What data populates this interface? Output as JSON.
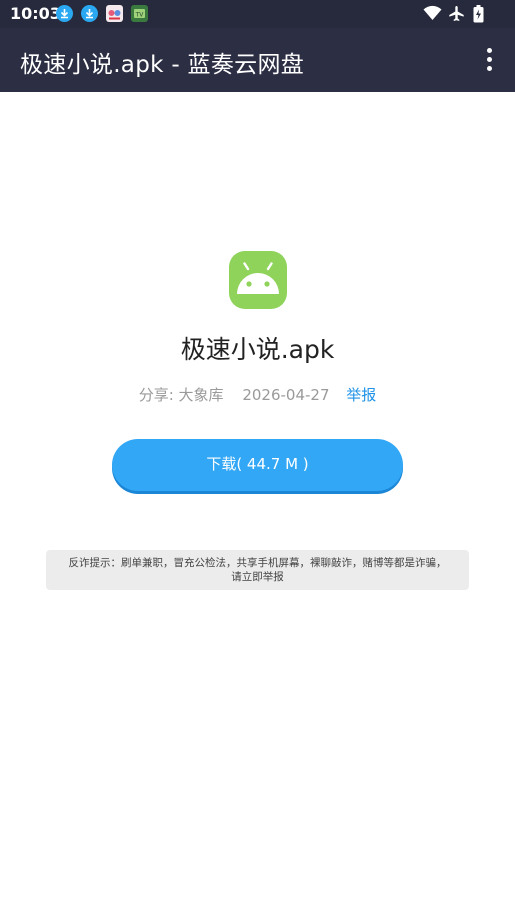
{
  "status_bar": {
    "time": "10:03",
    "notification_icons": [
      "download-icon",
      "download-icon",
      "app-notification-icon",
      "tv-app-icon"
    ],
    "right_icons": [
      "wifi-icon",
      "airplane-mode-icon",
      "battery-icon"
    ]
  },
  "app_bar": {
    "title": "极速小说.apk - 蓝奏云网盘",
    "menu_icon": "more-vert-icon",
    "background": "#2c2f44"
  },
  "file": {
    "icon": "android-icon",
    "name": "极速小说.apk",
    "share_label": "分享: 大象库",
    "date": "2026-04-27",
    "report_link": "举报"
  },
  "download": {
    "label": "下载( 44.7 M )",
    "color": "#32a7f6"
  },
  "notice": {
    "line1": "反诈提示：刷单兼职，冒充公检法，共享手机屏幕，裸聊敲诈，赌博等都是诈骗，",
    "line2": "请立即举报"
  }
}
